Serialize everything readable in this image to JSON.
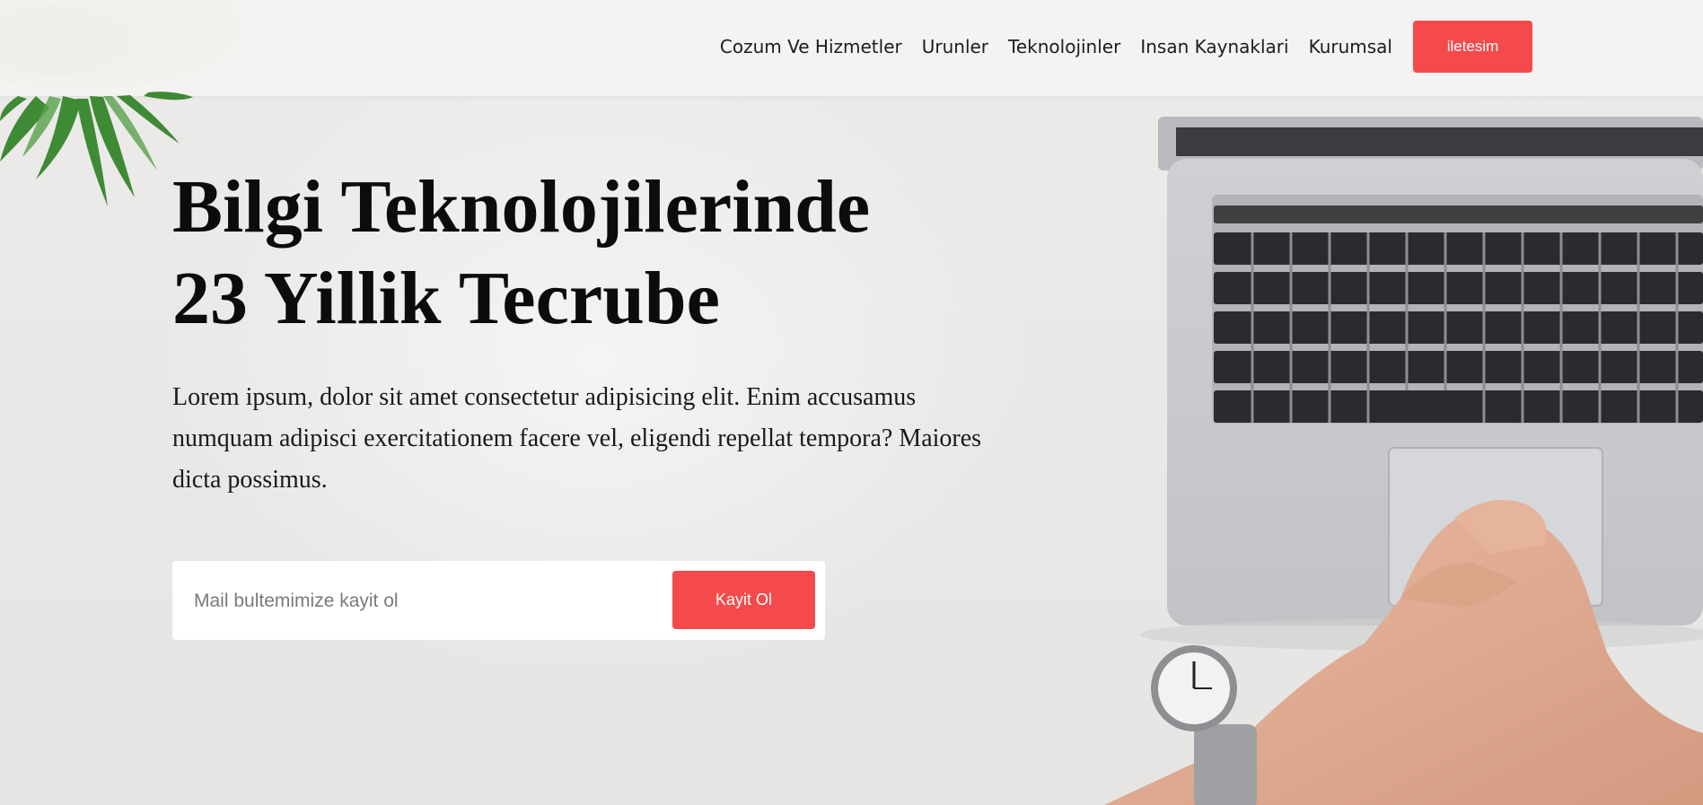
{
  "nav": {
    "items": [
      {
        "label": "Cozum Ve Hizmetler"
      },
      {
        "label": "Urunler"
      },
      {
        "label": "Teknolojinler"
      },
      {
        "label": "Insan Kaynaklari"
      },
      {
        "label": "Kurumsal"
      }
    ],
    "contact_label": "iletesim"
  },
  "hero": {
    "title_line1": "Bilgi Teknolojilerinde",
    "title_line2": "23 Yillik Tecrube",
    "description": "Lorem ipsum, dolor sit amet consectetur adipisicing elit. Enim accusamus numquam adipisci exercitationem facere vel, eligendi repellat tempora? Maiores dicta possimus.",
    "subscribe": {
      "placeholder": "Mail bultemimize kayit ol",
      "button_label": "Kayit Ol"
    }
  },
  "colors": {
    "accent": "#f54a4b",
    "background": "#e8e7e5",
    "text": "#0c0c0c"
  },
  "icons": [
    "plant-decoration",
    "laptop-photo"
  ]
}
